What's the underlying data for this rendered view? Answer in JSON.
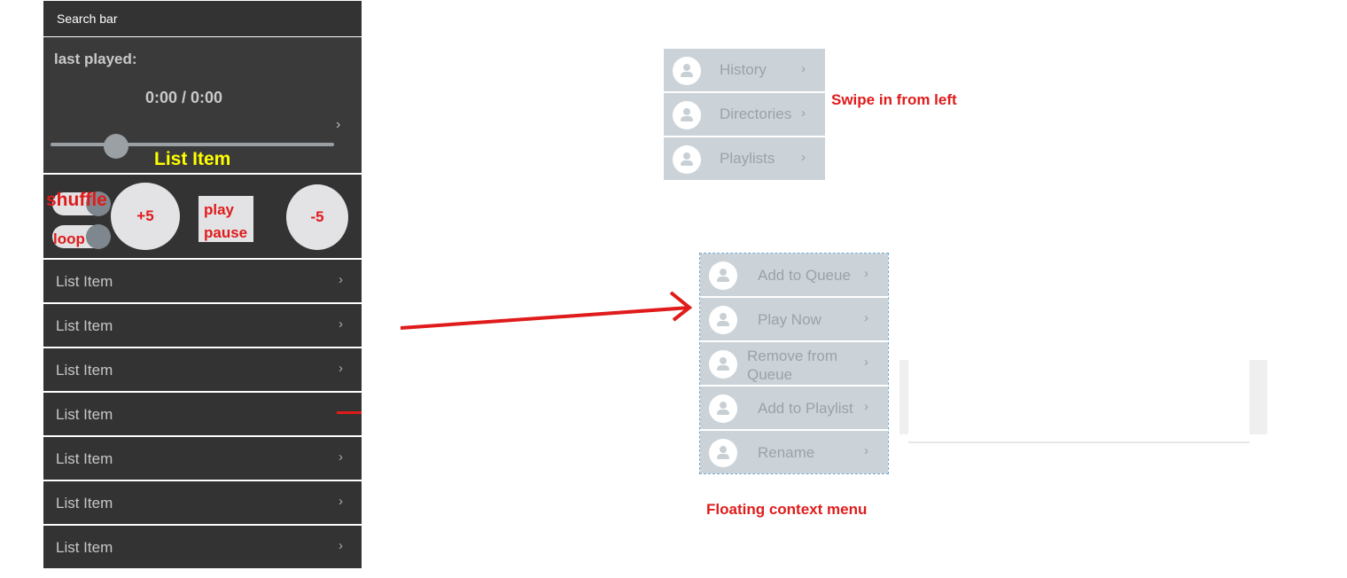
{
  "search_bar": {
    "label": "Search bar"
  },
  "player": {
    "last_played_label": "last played:",
    "time": "0:00 / 0:00",
    "slider_position": 0.23,
    "list_item_label": "List Item"
  },
  "controls": {
    "shuffle_label": "shuffle",
    "loop_label": "loop",
    "plus5_label": "+5",
    "play_label": "play",
    "pause_label": "pause",
    "minus5_label": "-5"
  },
  "list": {
    "items": [
      {
        "label": "List Item"
      },
      {
        "label": "List Item"
      },
      {
        "label": "List Item"
      },
      {
        "label": "List Item"
      },
      {
        "label": "List Item"
      },
      {
        "label": "List Item"
      },
      {
        "label": "List Item"
      }
    ]
  },
  "drawer": {
    "items": [
      {
        "label": "History"
      },
      {
        "label": "Directories"
      },
      {
        "label": "Playlists"
      }
    ],
    "note": "Swipe in from  left"
  },
  "context_menu": {
    "items": [
      {
        "label": "Add to Queue"
      },
      {
        "label": "Play Now"
      },
      {
        "label": "Remove from Queue"
      },
      {
        "label": "Add to Playlist"
      },
      {
        "label": "Rename"
      }
    ],
    "note": "Floating context menu"
  },
  "colors": {
    "annotation": "#e01b1b",
    "highlight": "#ffff00",
    "panel_dark": "#333333",
    "menu_bg": "#ccd3d8"
  },
  "icons": {
    "chevron": "chevron-right-icon",
    "avatar": "person-avatar-icon"
  }
}
